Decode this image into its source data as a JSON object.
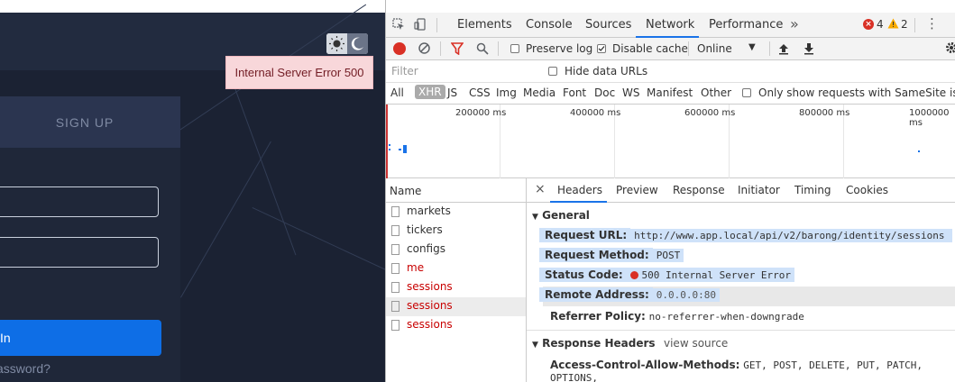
{
  "app": {
    "toast": "Internal Server Error 500",
    "signup_tab": "SIGN UP",
    "login_button": "In",
    "forgot_link": "assword?"
  },
  "devtools": {
    "tabs": [
      "Elements",
      "Console",
      "Sources",
      "Network",
      "Performance"
    ],
    "more_tabs": "»",
    "errors": "4",
    "warnings": "2",
    "preserve_log": "Preserve log",
    "disable_cache": "Disable cache",
    "throttle": "Online",
    "filter_placeholder": "Filter",
    "hide_data_urls": "Hide data URLs",
    "types": [
      "All",
      "XHR",
      "JS",
      "CSS",
      "Img",
      "Media",
      "Font",
      "Doc",
      "WS",
      "Manifest",
      "Other"
    ],
    "samesite": "Only show requests with SameSite issue",
    "timeline_ticks": [
      "200000 ms",
      "400000 ms",
      "600000 ms",
      "800000 ms",
      "1000000 ms"
    ],
    "name_header": "Name",
    "requests": [
      {
        "name": "markets",
        "color": "#333333"
      },
      {
        "name": "tickers",
        "color": "#333333"
      },
      {
        "name": "configs",
        "color": "#333333"
      },
      {
        "name": "me",
        "color": "#c80000"
      },
      {
        "name": "sessions",
        "color": "#c80000"
      },
      {
        "name": "sessions",
        "color": "#c80000"
      },
      {
        "name": "sessions",
        "color": "#c80000"
      }
    ],
    "detail_tabs": [
      "Headers",
      "Preview",
      "Response",
      "Initiator",
      "Timing",
      "Cookies"
    ],
    "general_title": "General",
    "general": {
      "request_url_label": "Request URL:",
      "request_url": "http://www.app.local/api/v2/barong/identity/sessions",
      "request_method_label": "Request Method:",
      "request_method": "POST",
      "status_code_label": "Status Code:",
      "status_code": "500 Internal Server Error",
      "remote_address_label": "Remote Address:",
      "remote_address": "0.0.0.0:80",
      "referrer_policy_label": "Referrer Policy:",
      "referrer_policy": "no-referrer-when-downgrade"
    },
    "response_headers_title": "Response Headers",
    "view_source": "view source",
    "acam_label": "Access-Control-Allow-Methods:",
    "acam_value": "GET, POST, DELETE, PUT, PATCH, OPTIONS,",
    "colors": {
      "accent": "#1a73e8",
      "error": "#d93025",
      "warning": "#f9ab00"
    }
  }
}
